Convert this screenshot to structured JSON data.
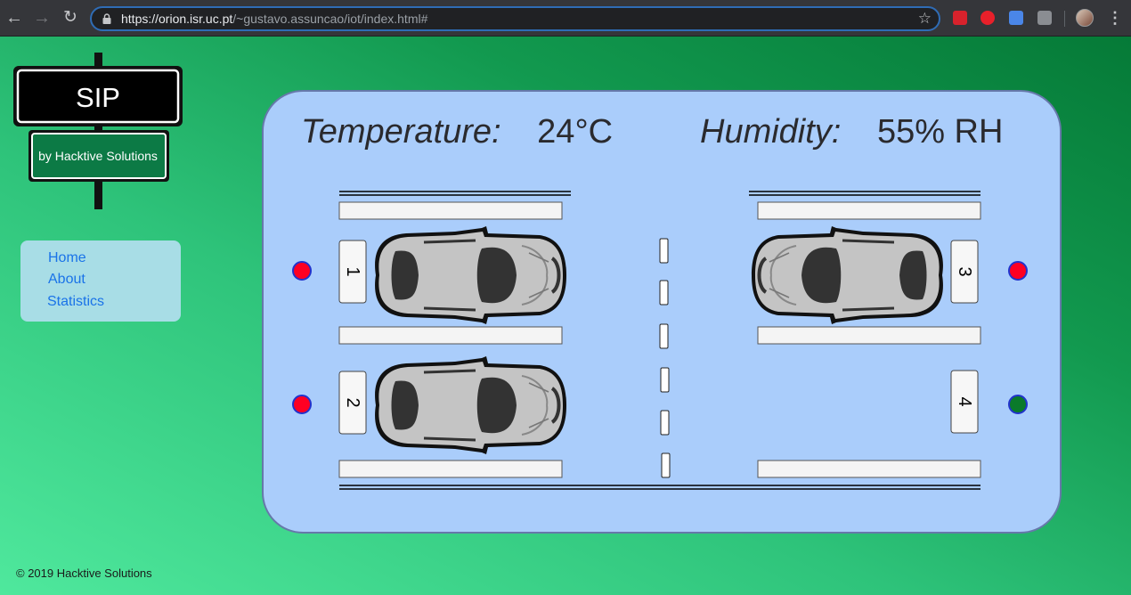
{
  "browser": {
    "url_host": "https://orion.isr.uc.pt",
    "url_path": "/~gustavo.assuncao/iot/index.html#"
  },
  "logo": {
    "title": "SIP",
    "subtitle": "by Hacktive Solutions"
  },
  "nav": {
    "items": [
      "Home",
      "About",
      "Statistics"
    ]
  },
  "readings": {
    "temperature_label": "Temperature:",
    "temperature_value": "24°C",
    "humidity_label": "Humidity:",
    "humidity_value": "55% RH"
  },
  "spots": [
    {
      "number": "1",
      "occupied": true,
      "status": "occupied",
      "status_color": "#ff0022"
    },
    {
      "number": "2",
      "occupied": true,
      "status": "occupied",
      "status_color": "#ff0022"
    },
    {
      "number": "3",
      "occupied": true,
      "status": "occupied",
      "status_color": "#ff0022"
    },
    {
      "number": "4",
      "occupied": false,
      "status": "free",
      "status_color": "#0a7a2a"
    }
  ],
  "footer": "© 2019 Hacktive Solutions",
  "colors": {
    "panel_bg": "#aacdfb",
    "link": "#1a73e8",
    "status_border": "#2233cc"
  }
}
